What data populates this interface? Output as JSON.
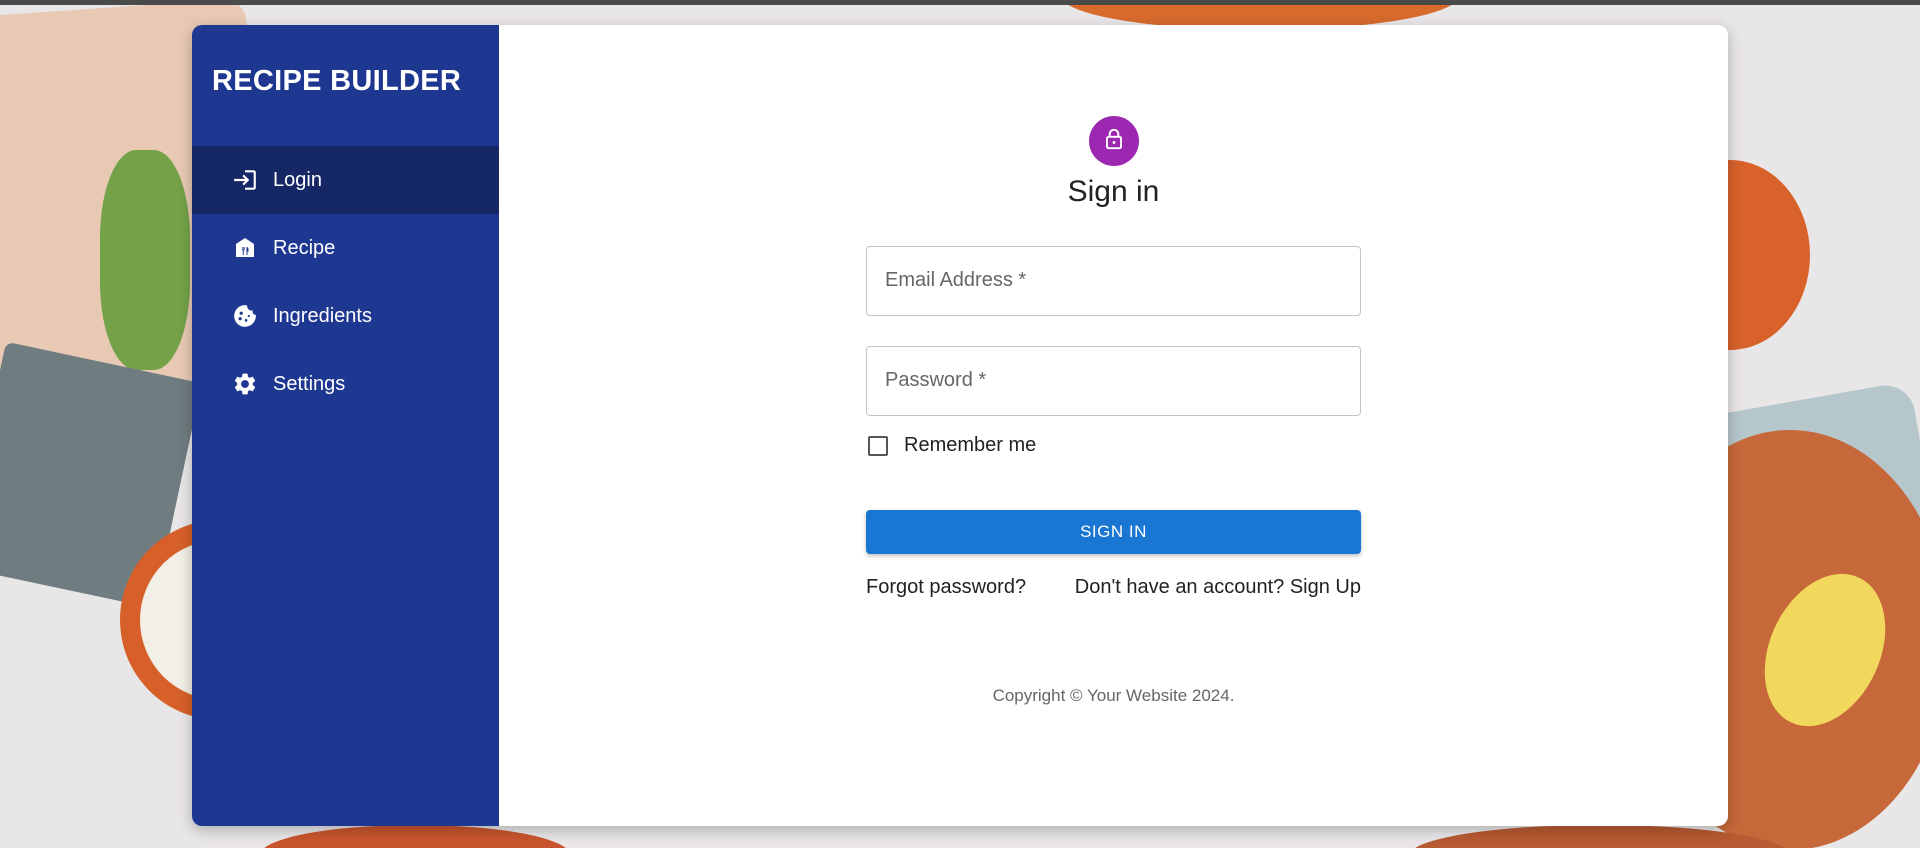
{
  "app": {
    "brand": "RECIPE BUILDER"
  },
  "sidebar": {
    "items": [
      {
        "label": "Login",
        "icon": "login-icon",
        "active": true
      },
      {
        "label": "Recipe",
        "icon": "recipe-icon",
        "active": false
      },
      {
        "label": "Ingredients",
        "icon": "cookie-icon",
        "active": false
      },
      {
        "label": "Settings",
        "icon": "gear-icon",
        "active": false
      }
    ]
  },
  "form": {
    "avatar_icon": "lock-icon",
    "title": "Sign in",
    "email": {
      "label": "Email Address *",
      "value": ""
    },
    "password": {
      "label": "Password *",
      "value": ""
    },
    "remember_label": "Remember me",
    "remember_checked": false,
    "submit_label": "Sign In",
    "forgot_label": "Forgot password?",
    "signup_label": "Don't have an account? Sign Up"
  },
  "footer": {
    "copyright": "Copyright © Your Website 2024."
  },
  "colors": {
    "sidebar": "#1e3790",
    "sidebar_active": "#152764",
    "avatar": "#9c27b0",
    "primary_button": "#1976d2"
  }
}
